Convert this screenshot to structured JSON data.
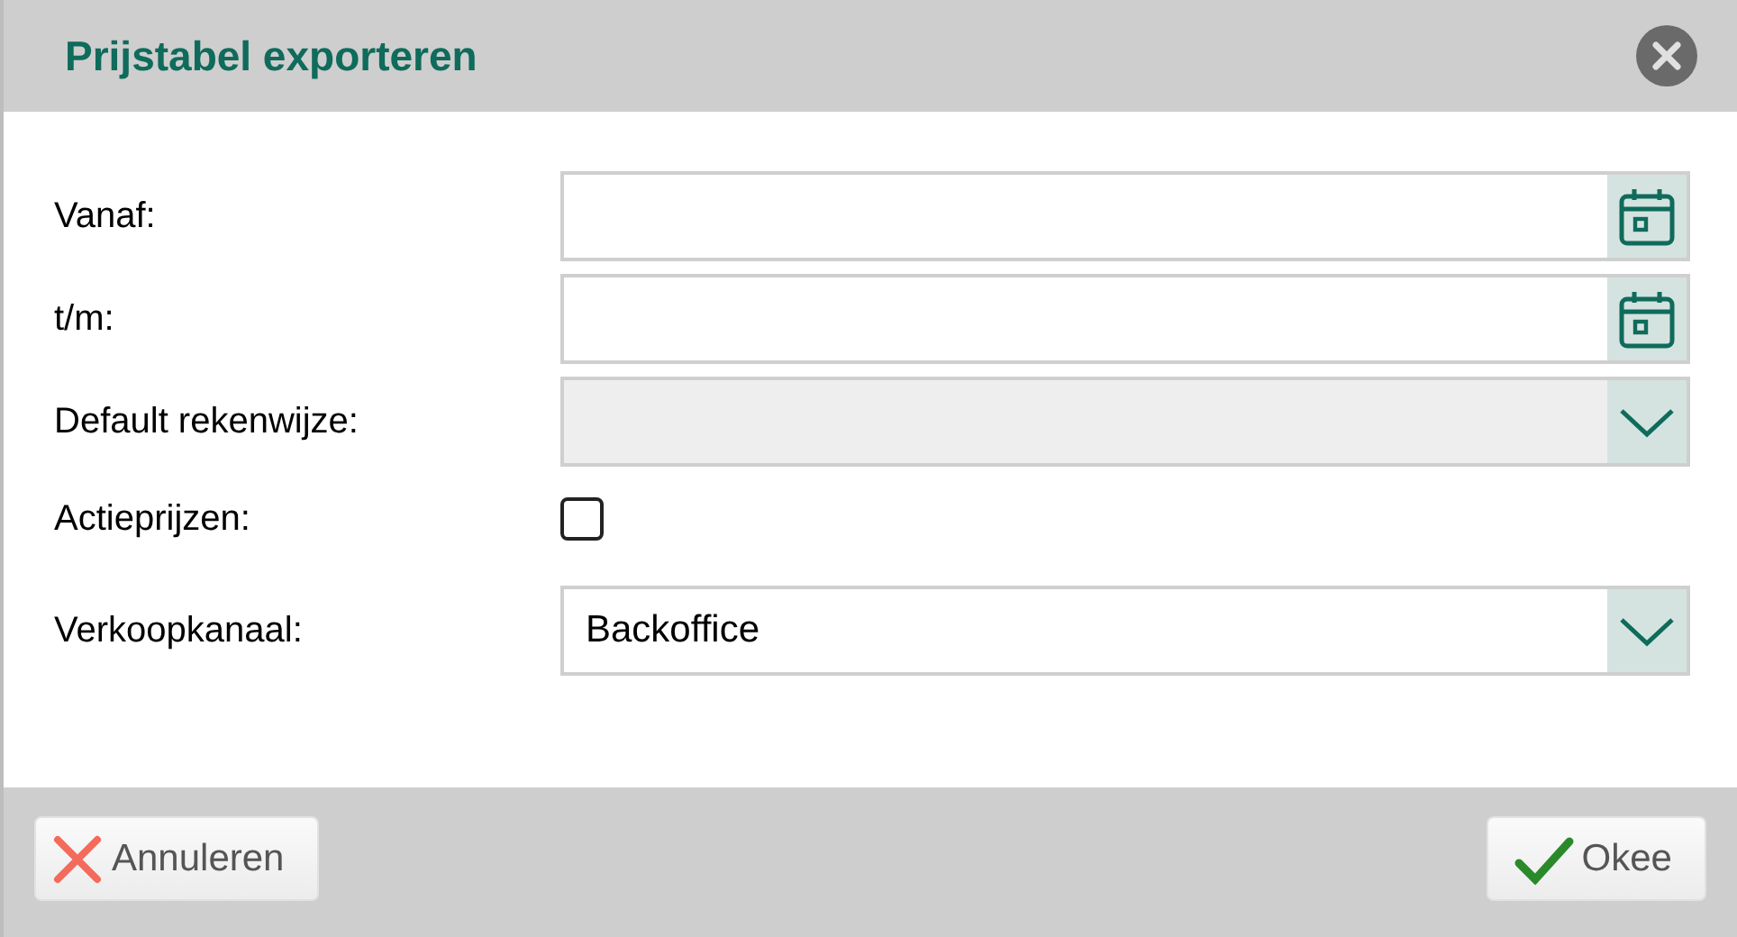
{
  "dialog": {
    "title": "Prijstabel exporteren"
  },
  "fields": [
    {
      "label": "Vanaf:",
      "kind": "date",
      "disabled": false
    },
    {
      "label": "t/m:",
      "kind": "date",
      "disabled": false
    },
    {
      "label": "Default rekenwijze:",
      "kind": "select",
      "disabled": true
    },
    {
      "label": "Actieprijzen:",
      "kind": "checkbox",
      "checked": false
    },
    {
      "label": "Verkoopkanaal:",
      "kind": "select",
      "disabled": false,
      "value": "Backoffice"
    }
  ],
  "buttons": [
    {
      "label": "Annuleren",
      "kind": "cancel"
    },
    {
      "label": "Okee",
      "kind": "ok"
    }
  ]
}
